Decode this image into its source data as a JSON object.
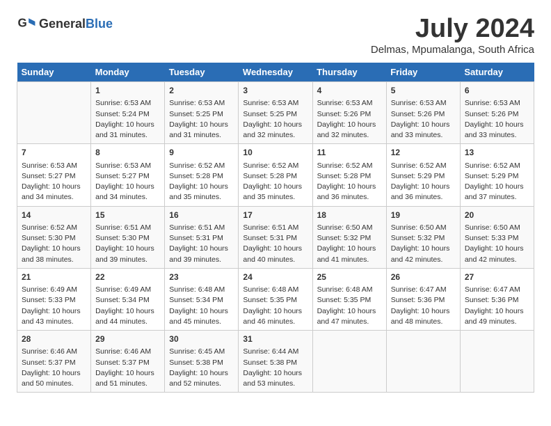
{
  "header": {
    "logo_general": "General",
    "logo_blue": "Blue",
    "month_title": "July 2024",
    "location": "Delmas, Mpumalanga, South Africa"
  },
  "calendar": {
    "days_of_week": [
      "Sunday",
      "Monday",
      "Tuesday",
      "Wednesday",
      "Thursday",
      "Friday",
      "Saturday"
    ],
    "weeks": [
      [
        {
          "day": "",
          "info": ""
        },
        {
          "day": "1",
          "info": "Sunrise: 6:53 AM\nSunset: 5:24 PM\nDaylight: 10 hours and 31 minutes."
        },
        {
          "day": "2",
          "info": "Sunrise: 6:53 AM\nSunset: 5:25 PM\nDaylight: 10 hours and 31 minutes."
        },
        {
          "day": "3",
          "info": "Sunrise: 6:53 AM\nSunset: 5:25 PM\nDaylight: 10 hours and 32 minutes."
        },
        {
          "day": "4",
          "info": "Sunrise: 6:53 AM\nSunset: 5:26 PM\nDaylight: 10 hours and 32 minutes."
        },
        {
          "day": "5",
          "info": "Sunrise: 6:53 AM\nSunset: 5:26 PM\nDaylight: 10 hours and 33 minutes."
        },
        {
          "day": "6",
          "info": "Sunrise: 6:53 AM\nSunset: 5:26 PM\nDaylight: 10 hours and 33 minutes."
        }
      ],
      [
        {
          "day": "7",
          "info": "Sunrise: 6:53 AM\nSunset: 5:27 PM\nDaylight: 10 hours and 34 minutes."
        },
        {
          "day": "8",
          "info": "Sunrise: 6:53 AM\nSunset: 5:27 PM\nDaylight: 10 hours and 34 minutes."
        },
        {
          "day": "9",
          "info": "Sunrise: 6:52 AM\nSunset: 5:28 PM\nDaylight: 10 hours and 35 minutes."
        },
        {
          "day": "10",
          "info": "Sunrise: 6:52 AM\nSunset: 5:28 PM\nDaylight: 10 hours and 35 minutes."
        },
        {
          "day": "11",
          "info": "Sunrise: 6:52 AM\nSunset: 5:28 PM\nDaylight: 10 hours and 36 minutes."
        },
        {
          "day": "12",
          "info": "Sunrise: 6:52 AM\nSunset: 5:29 PM\nDaylight: 10 hours and 36 minutes."
        },
        {
          "day": "13",
          "info": "Sunrise: 6:52 AM\nSunset: 5:29 PM\nDaylight: 10 hours and 37 minutes."
        }
      ],
      [
        {
          "day": "14",
          "info": "Sunrise: 6:52 AM\nSunset: 5:30 PM\nDaylight: 10 hours and 38 minutes."
        },
        {
          "day": "15",
          "info": "Sunrise: 6:51 AM\nSunset: 5:30 PM\nDaylight: 10 hours and 39 minutes."
        },
        {
          "day": "16",
          "info": "Sunrise: 6:51 AM\nSunset: 5:31 PM\nDaylight: 10 hours and 39 minutes."
        },
        {
          "day": "17",
          "info": "Sunrise: 6:51 AM\nSunset: 5:31 PM\nDaylight: 10 hours and 40 minutes."
        },
        {
          "day": "18",
          "info": "Sunrise: 6:50 AM\nSunset: 5:32 PM\nDaylight: 10 hours and 41 minutes."
        },
        {
          "day": "19",
          "info": "Sunrise: 6:50 AM\nSunset: 5:32 PM\nDaylight: 10 hours and 42 minutes."
        },
        {
          "day": "20",
          "info": "Sunrise: 6:50 AM\nSunset: 5:33 PM\nDaylight: 10 hours and 42 minutes."
        }
      ],
      [
        {
          "day": "21",
          "info": "Sunrise: 6:49 AM\nSunset: 5:33 PM\nDaylight: 10 hours and 43 minutes."
        },
        {
          "day": "22",
          "info": "Sunrise: 6:49 AM\nSunset: 5:34 PM\nDaylight: 10 hours and 44 minutes."
        },
        {
          "day": "23",
          "info": "Sunrise: 6:48 AM\nSunset: 5:34 PM\nDaylight: 10 hours and 45 minutes."
        },
        {
          "day": "24",
          "info": "Sunrise: 6:48 AM\nSunset: 5:35 PM\nDaylight: 10 hours and 46 minutes."
        },
        {
          "day": "25",
          "info": "Sunrise: 6:48 AM\nSunset: 5:35 PM\nDaylight: 10 hours and 47 minutes."
        },
        {
          "day": "26",
          "info": "Sunrise: 6:47 AM\nSunset: 5:36 PM\nDaylight: 10 hours and 48 minutes."
        },
        {
          "day": "27",
          "info": "Sunrise: 6:47 AM\nSunset: 5:36 PM\nDaylight: 10 hours and 49 minutes."
        }
      ],
      [
        {
          "day": "28",
          "info": "Sunrise: 6:46 AM\nSunset: 5:37 PM\nDaylight: 10 hours and 50 minutes."
        },
        {
          "day": "29",
          "info": "Sunrise: 6:46 AM\nSunset: 5:37 PM\nDaylight: 10 hours and 51 minutes."
        },
        {
          "day": "30",
          "info": "Sunrise: 6:45 AM\nSunset: 5:38 PM\nDaylight: 10 hours and 52 minutes."
        },
        {
          "day": "31",
          "info": "Sunrise: 6:44 AM\nSunset: 5:38 PM\nDaylight: 10 hours and 53 minutes."
        },
        {
          "day": "",
          "info": ""
        },
        {
          "day": "",
          "info": ""
        },
        {
          "day": "",
          "info": ""
        }
      ]
    ]
  }
}
